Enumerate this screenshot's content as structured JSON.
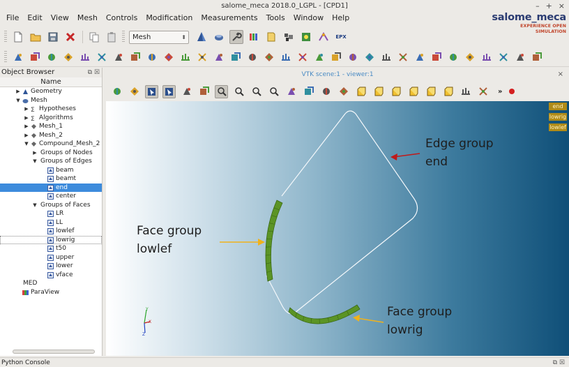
{
  "window": {
    "title": "salome_meca 2018.0_LGPL - [CPD1]",
    "controls": [
      "–",
      "+",
      "×"
    ]
  },
  "menu": [
    "File",
    "Edit",
    "View",
    "Mesh",
    "Controls",
    "Modification",
    "Measurements",
    "Tools",
    "Window",
    "Help"
  ],
  "logo": {
    "name": "salome_meca",
    "tagline": "EXPERIENCE OPEN SIMULATION",
    "name_color": "#2b3c72",
    "tag_color": "#c0442a"
  },
  "toolbar1": {
    "module_select": "Mesh",
    "buttons_left": [
      "new-document-icon",
      "open-folder-icon",
      "save-icon",
      "close-document-icon"
    ],
    "buttons_mid": [
      "copy-icon",
      "paste-icon"
    ],
    "buttons_modules": [
      "geometry-module-icon",
      "smesh-module-icon",
      "wrench-icon",
      "paravis-module-icon",
      "yacs-module-icon",
      "jobmanager-icon",
      "asterstudy-icon",
      "eficas-icon"
    ],
    "epx_label": "EPX"
  },
  "toolbar2": {
    "buttons": [
      "create-mesh-icon",
      "create-submesh-icon",
      "edit-mesh-icon",
      "compute-icon",
      "evaluate-icon",
      "preview-icon",
      "import-icon",
      "mesh-info-icon",
      "group-icon",
      "node-icon",
      "edge-icon",
      "face-icon",
      "volume-icon",
      "quadratic-icon",
      "polygon-icon",
      "transform-icon",
      "translation-icon",
      "rotation-icon",
      "symmetry-icon",
      "scale-icon",
      "merge-nodes-icon",
      "sew-icon",
      "extrusion-icon",
      "revolution-icon",
      "split-icon",
      "smoothing-icon",
      "orient-icon",
      "diagonal-icon",
      "reorient-icon",
      "union-icon",
      "cut-icon",
      "intersect-icon"
    ]
  },
  "object_browser": {
    "title": "Object Browser",
    "column_header": "Name",
    "tree": [
      {
        "label": "Geometry",
        "level": 1,
        "arrow": "right",
        "icon": "geometry-icon"
      },
      {
        "label": "Mesh",
        "level": 1,
        "arrow": "down",
        "icon": "mesh-icon"
      },
      {
        "label": "Hypotheses",
        "level": 2,
        "arrow": "right",
        "icon": "hypothesis-icon"
      },
      {
        "label": "Algorithms",
        "level": 2,
        "arrow": "right",
        "icon": "algorithm-icon"
      },
      {
        "label": "Mesh_1",
        "level": 2,
        "arrow": "right",
        "icon": "mesh-object-icon"
      },
      {
        "label": "Mesh_2",
        "level": 2,
        "arrow": "right",
        "icon": "mesh-object-icon"
      },
      {
        "label": "Compound_Mesh_2",
        "level": 2,
        "arrow": "down",
        "icon": "mesh-object-icon"
      },
      {
        "label": "Groups of Nodes",
        "level": 3,
        "arrow": "right",
        "icon": ""
      },
      {
        "label": "Groups of Edges",
        "level": 3,
        "arrow": "down",
        "icon": ""
      },
      {
        "label": "beam",
        "level": 4,
        "arrow": "",
        "icon": "group-icon"
      },
      {
        "label": "beamt",
        "level": 4,
        "arrow": "",
        "icon": "group-icon"
      },
      {
        "label": "end",
        "level": 4,
        "arrow": "",
        "icon": "group-icon",
        "selected": true
      },
      {
        "label": "center",
        "level": 4,
        "arrow": "",
        "icon": "group-icon"
      },
      {
        "label": "Groups of Faces",
        "level": 3,
        "arrow": "down",
        "icon": ""
      },
      {
        "label": "LR",
        "level": 4,
        "arrow": "",
        "icon": "group-icon"
      },
      {
        "label": "LL",
        "level": 4,
        "arrow": "",
        "icon": "group-icon"
      },
      {
        "label": "lowlef",
        "level": 4,
        "arrow": "",
        "icon": "group-icon"
      },
      {
        "label": "lowrig",
        "level": 4,
        "arrow": "",
        "icon": "group-icon",
        "outlined": true
      },
      {
        "label": "t50",
        "level": 4,
        "arrow": "",
        "icon": "group-icon"
      },
      {
        "label": "upper",
        "level": 4,
        "arrow": "",
        "icon": "group-icon"
      },
      {
        "label": "lower",
        "level": 4,
        "arrow": "",
        "icon": "group-icon"
      },
      {
        "label": "vface",
        "level": 4,
        "arrow": "",
        "icon": "group-icon"
      },
      {
        "label": "MED",
        "level": 0,
        "arrow": "",
        "icon": ""
      },
      {
        "label": "ParaView",
        "level": 1,
        "arrow": "",
        "icon": "paraview-icon"
      }
    ]
  },
  "viewer": {
    "title": "VTK scene:1 - viewer:1",
    "toolbar_buttons": [
      "dump-view-icon",
      "interaction-style-icon",
      "zooming-style-icon",
      "selection-icon",
      "show-trihedron-icon",
      "fit-selection-icon",
      "rectangle-selection-icon",
      "fit-area-icon",
      "fit-all-icon",
      "zoom-icon",
      "pan-icon",
      "global-pan-icon",
      "rotate-icon",
      "rotation-point-icon",
      "view-front-icon",
      "view-back-icon",
      "view-top-icon",
      "view-bottom-icon",
      "view-left-icon",
      "view-right-icon",
      "rotate-clockwise-icon",
      "reset-view-icon"
    ],
    "legend_tags": [
      "end",
      "lowrig",
      "lowlef"
    ],
    "legend_color": "#b08b18",
    "annotations": [
      {
        "lines": [
          "Edge group",
          "end"
        ],
        "arrow_color": "#c01a1a"
      },
      {
        "lines": [
          "Face group",
          "lowlef"
        ],
        "arrow_color": "#f0b21c"
      },
      {
        "lines": [
          "Face group",
          "lowrig"
        ],
        "arrow_color": "#f0b21c"
      }
    ],
    "face_color": "#5b9425"
  },
  "console": {
    "title": "Python Console"
  }
}
